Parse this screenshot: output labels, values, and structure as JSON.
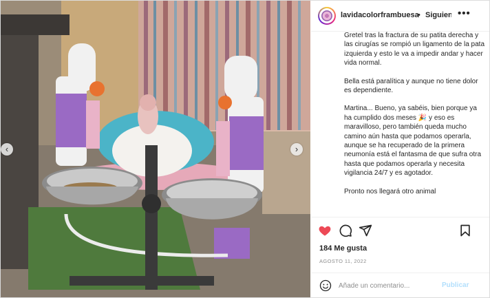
{
  "post": {
    "username": "lavidacolorframbuesa",
    "separator": "•",
    "follow_label": "Siguiendo",
    "more_label": "•••",
    "caption_paragraphs": [
      "Gretel tras la fractura de su patita derecha y las cirugías se rompió un ligamento de la pata izquierda y esto le va a impedir andar y hacer vida normal.",
      "Bella está paralítica y aunque no tiene dolor es dependiente.",
      "Martina... Bueno, ya sabéis, bien porque ya ha cumplido dos meses 🎉 y eso es maravilloso, pero también queda mucho camino aún hasta que podamos operarla, aunque se ha recuperado de la primera neumonía está el fantasma de que sufra otra hasta que podamos operarla y necesita vigilancia 24/7 y es agotador.",
      "Pronto nos llegará otro animal"
    ],
    "likes": "184 Me gusta",
    "date": "AGOSTO 11, 2022",
    "comment_placeholder": "Añade un comentario...",
    "publish_label": "Publicar",
    "like_color": "#ed4956",
    "prev_arrow": "‹",
    "next_arrow": "›"
  },
  "icons": {
    "like": "heart-icon",
    "comment": "comment-icon",
    "share": "paper-plane-icon",
    "save": "bookmark-icon",
    "emoji": "smiley-icon"
  }
}
